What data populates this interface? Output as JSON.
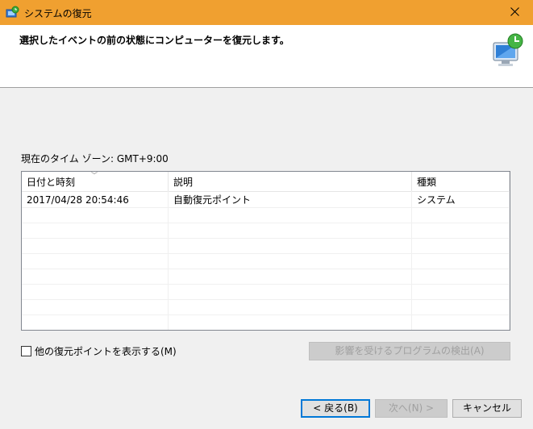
{
  "window": {
    "title": "システムの復元"
  },
  "header": {
    "instruction": "選択したイベントの前の状態にコンピューターを復元します。"
  },
  "timezone_label": "現在のタイム ゾーン: GMT+9:00",
  "table": {
    "columns": [
      "日付と時刻",
      "説明",
      "種類"
    ],
    "rows": [
      {
        "datetime": "2017/04/28 20:54:46",
        "description": "自動復元ポイント",
        "type": "システム"
      }
    ]
  },
  "show_more_label": "他の復元ポイントを表示する(M)",
  "scan_button_label": "影響を受けるプログラムの検出(A)",
  "buttons": {
    "back": "< 戻る(B)",
    "next": "次へ(N) >",
    "cancel": "キャンセル"
  },
  "colors": {
    "titlebar": "#f0a030",
    "accent": "#0078d7"
  },
  "icons": {
    "app": "system-restore-icon",
    "close": "close-icon",
    "hero": "computer-restore-icon"
  }
}
